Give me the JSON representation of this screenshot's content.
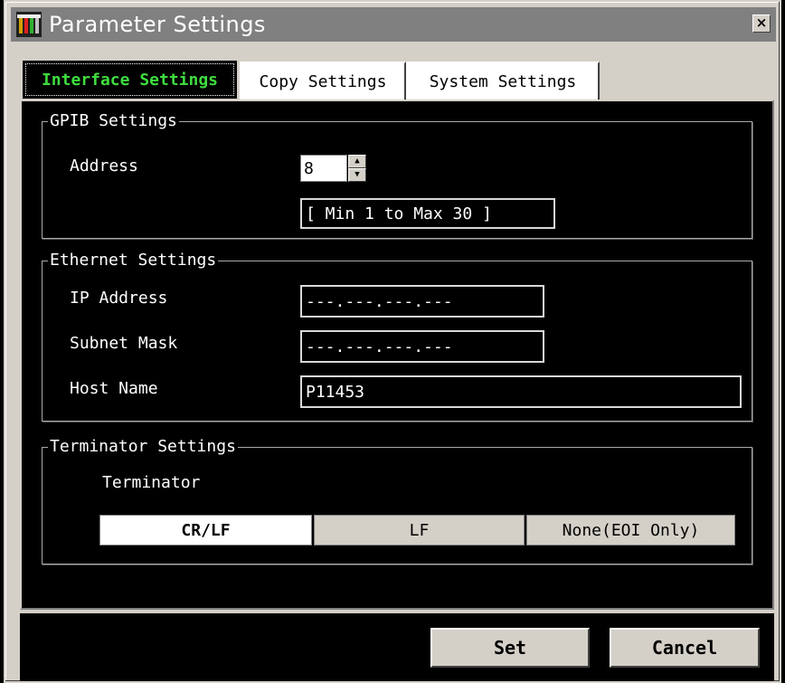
{
  "window": {
    "title": "Parameter Settings",
    "icon": "wrench-tools-icon",
    "close_glyph": "×"
  },
  "tabs": [
    {
      "label": "Interface Settings",
      "active": true
    },
    {
      "label": "Copy Settings",
      "active": false
    },
    {
      "label": "System Settings",
      "active": false
    }
  ],
  "gpib": {
    "legend": "GPIB Settings",
    "address_label": "Address",
    "address_value": "8",
    "range_text": "[ Min 1  to  Max 30 ]"
  },
  "ethernet": {
    "legend": "Ethernet Settings",
    "ip_label": "IP Address",
    "ip_value": "---.---.---.---",
    "subnet_label": "Subnet Mask",
    "subnet_value": "---.---.---.---",
    "host_label": "Host Name",
    "host_value": "P11453"
  },
  "terminator": {
    "legend": "Terminator Settings",
    "label": "Terminator",
    "options": [
      {
        "label": "CR/LF",
        "selected": true
      },
      {
        "label": "LF",
        "selected": false
      },
      {
        "label": "None(EOI Only)",
        "selected": false
      }
    ]
  },
  "buttons": {
    "set": "Set",
    "cancel": "Cancel"
  },
  "colors": {
    "active_tab_text": "#3fdc3f",
    "titlebar": "#808080",
    "panel": "#000000"
  }
}
